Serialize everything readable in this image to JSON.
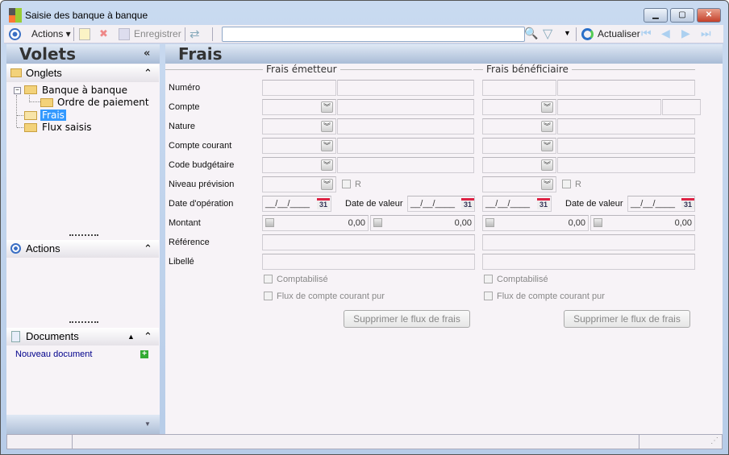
{
  "window": {
    "title": "Saisie des banque à banque",
    "minimize": "▁",
    "maximize": "▢",
    "close": "✕"
  },
  "toolbar": {
    "actions": "Actions ▾",
    "save": "Enregistrer",
    "search_value": "",
    "refresh": "Actualiser"
  },
  "left": {
    "title": "Volets",
    "collapse": "«",
    "onglets": {
      "title": "Onglets",
      "items": [
        {
          "label": "Banque à banque"
        },
        {
          "label": "Ordre de paiement"
        },
        {
          "label": "Frais"
        },
        {
          "label": "Flux saisis"
        }
      ]
    },
    "actions": {
      "title": "Actions"
    },
    "documents": {
      "title": "Documents",
      "new_doc": "Nouveau document"
    }
  },
  "main": {
    "title": "Frais",
    "labels": [
      "Numéro",
      "Compte",
      "Nature",
      "Compte courant",
      "Code budgétaire",
      "Niveau prévision",
      "Date d'opération",
      "Montant",
      "Référence",
      "Libellé"
    ],
    "sides": [
      {
        "legend": "Frais émetteur",
        "date_op": "__/__/____",
        "date_val_label": "Date de valeur",
        "date_val": "__/__/____",
        "montant1": "0,00",
        "montant2": "0,00",
        "r": "R",
        "comptabilise": "Comptabilisé",
        "flux_pur": "Flux de compte courant pur",
        "delete": "Supprimer le flux de frais"
      },
      {
        "legend": "Frais bénéficiaire",
        "date_op": "__/__/____",
        "date_val_label": "Date de valeur",
        "date_val": "__/__/____",
        "montant1": "0,00",
        "montant2": "0,00",
        "r": "R",
        "comptabilise": "Comptabilisé",
        "flux_pur": "Flux de compte courant pur",
        "delete": "Supprimer le flux de frais"
      }
    ],
    "calendar": "31"
  },
  "colors": {
    "accent": "#3399ff",
    "link": "#00008b"
  }
}
